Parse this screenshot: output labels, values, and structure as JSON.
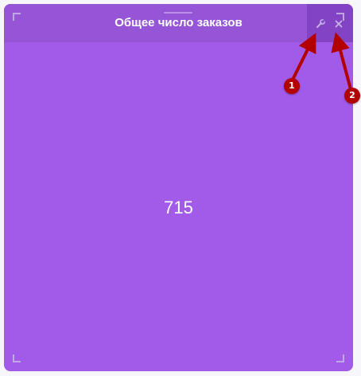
{
  "widget": {
    "title": "Общее число заказов",
    "value": "715"
  },
  "controls": {
    "settings_icon": "wrench-icon",
    "close_icon": "close-icon"
  },
  "annotations": {
    "marker_1": "1",
    "marker_2": "2"
  },
  "colors": {
    "widget_background": "#a25ae9",
    "header_background": "#9555d6",
    "controls_background": "#8244c4",
    "annotation_red": "#b30000"
  }
}
